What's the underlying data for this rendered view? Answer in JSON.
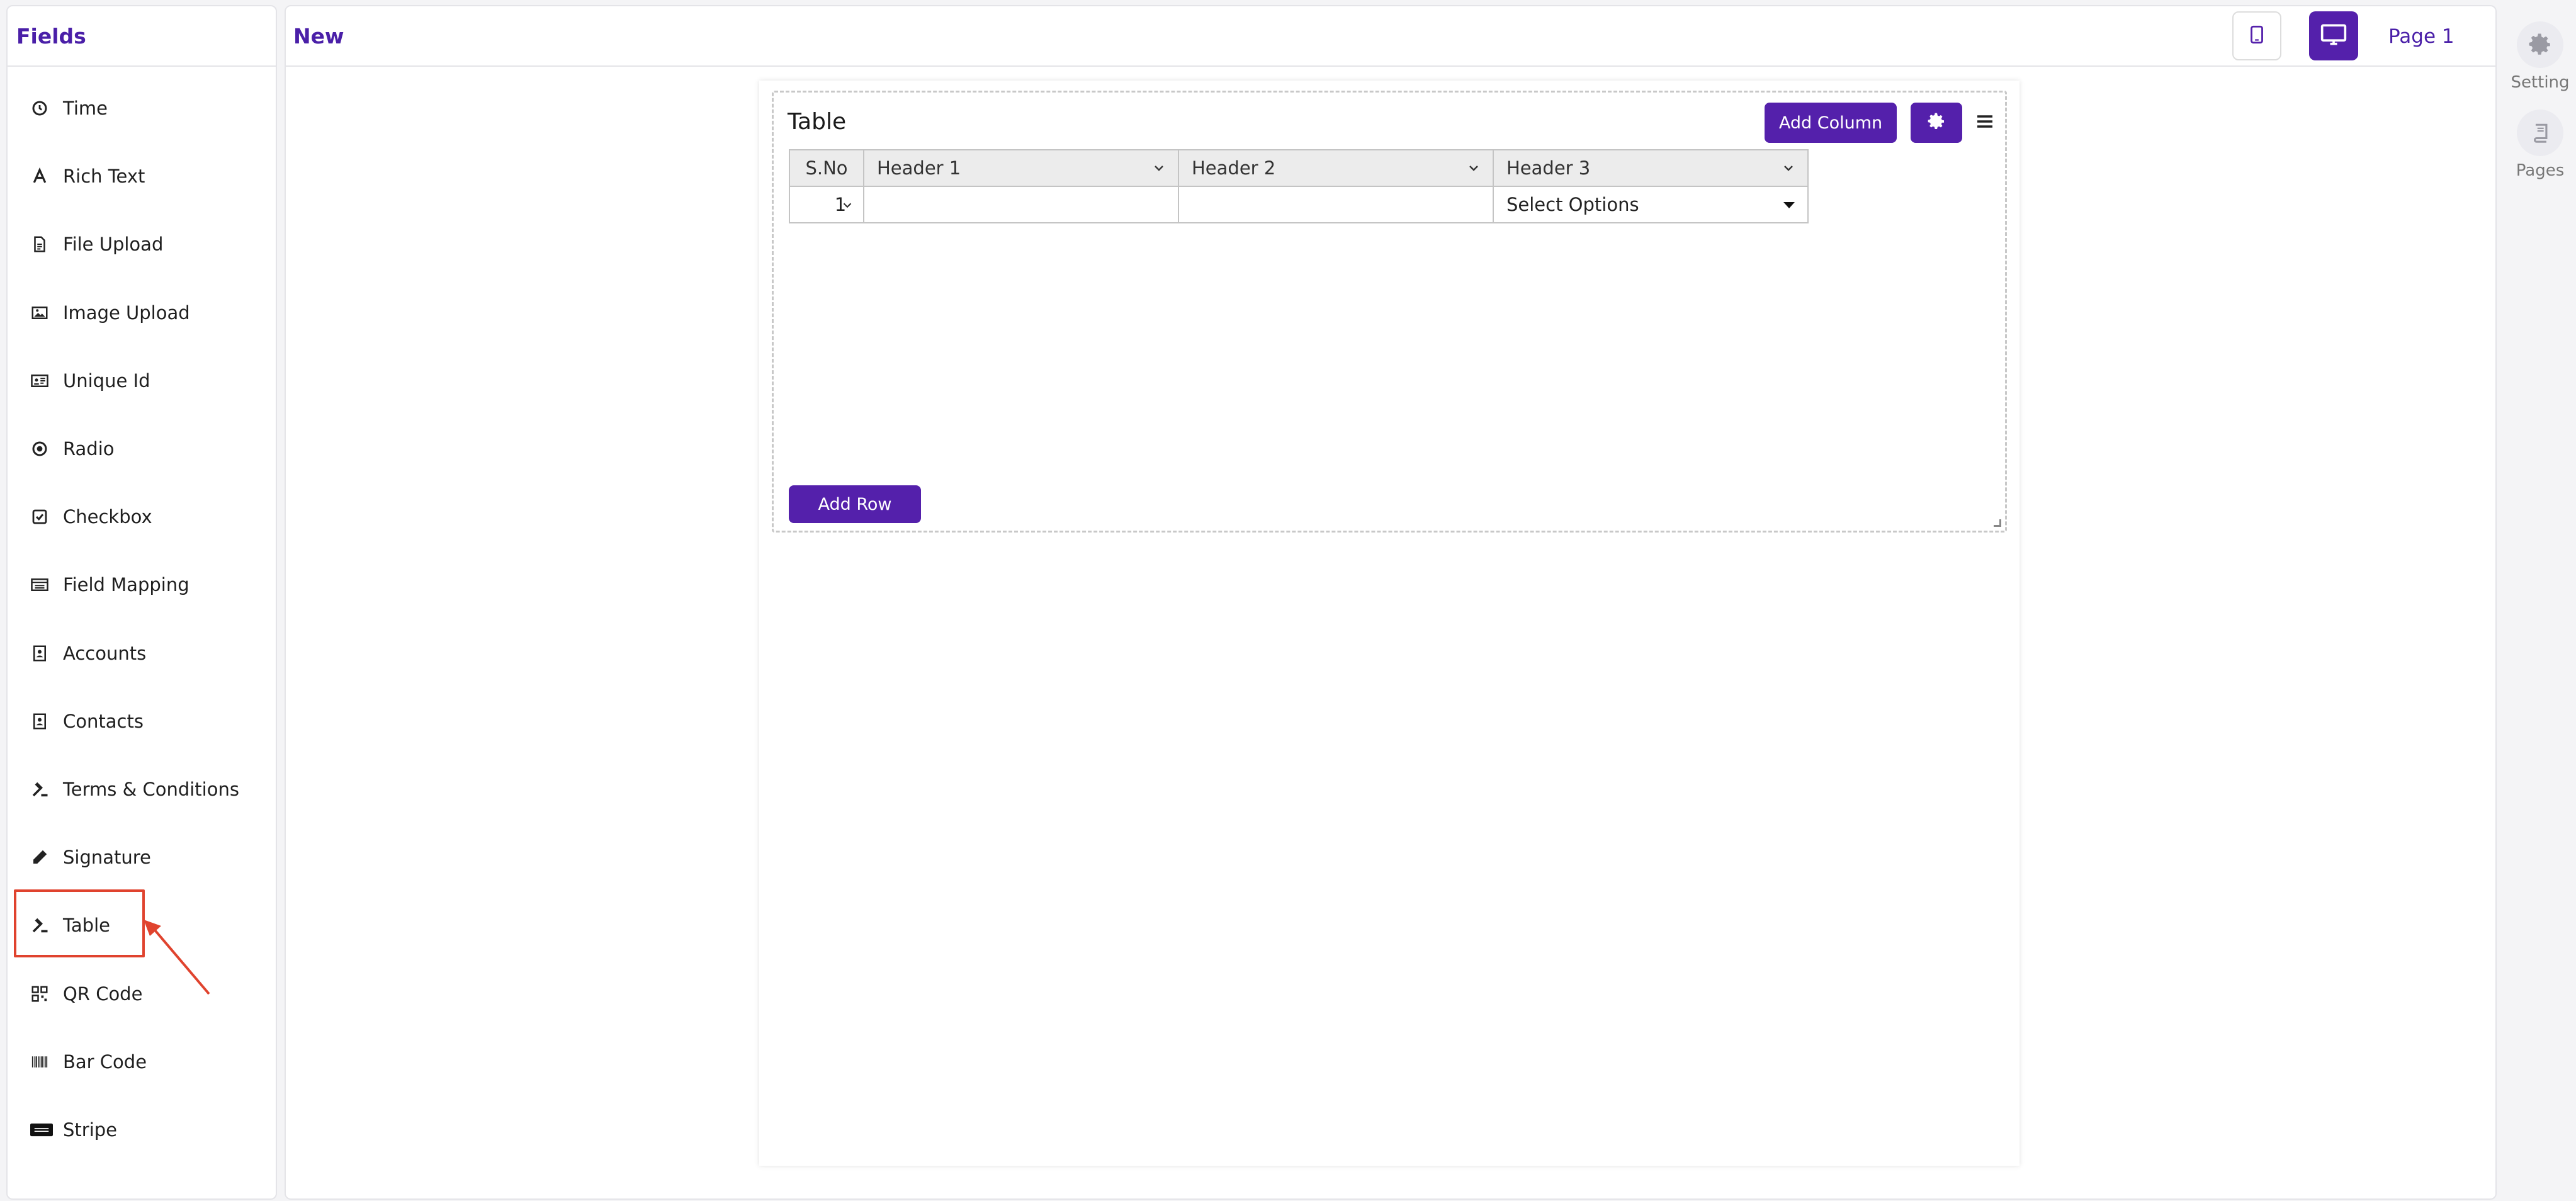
{
  "sidebar": {
    "title": "Fields",
    "items": [
      {
        "label": "Time",
        "icon": "clock-icon"
      },
      {
        "label": "Rich Text",
        "icon": "font-icon"
      },
      {
        "label": "File Upload",
        "icon": "file-icon"
      },
      {
        "label": "Image Upload",
        "icon": "image-icon"
      },
      {
        "label": "Unique Id",
        "icon": "id-card-icon"
      },
      {
        "label": "Radio",
        "icon": "radio-icon"
      },
      {
        "label": "Checkbox",
        "icon": "checkbox-icon"
      },
      {
        "label": "Field Mapping",
        "icon": "list-icon"
      },
      {
        "label": "Accounts",
        "icon": "contact-book-icon"
      },
      {
        "label": "Contacts",
        "icon": "contact-book-icon"
      },
      {
        "label": "Terms & Conditions",
        "icon": "gavel-icon"
      },
      {
        "label": "Signature",
        "icon": "pen-icon"
      },
      {
        "label": "Table",
        "icon": "gavel-icon"
      },
      {
        "label": "QR Code",
        "icon": "qr-code-icon"
      },
      {
        "label": "Bar Code",
        "icon": "barcode-icon"
      },
      {
        "label": "Stripe",
        "icon": "stripe-icon"
      }
    ]
  },
  "header": {
    "form_name": "New",
    "page_label": "Page 1"
  },
  "widget": {
    "title": "Table",
    "add_column_label": "Add Column",
    "add_row_label": "Add Row",
    "columns": [
      "S.No",
      "Header 1",
      "Header 2",
      "Header 3"
    ],
    "rows": [
      {
        "sno": "1",
        "h1": "",
        "h2": "",
        "h3": "Select Options"
      }
    ]
  },
  "right_rail": {
    "setting_label": "Setting",
    "pages_label": "Pages"
  },
  "colors": {
    "accent": "#5420ab",
    "highlight": "#e0432e"
  }
}
